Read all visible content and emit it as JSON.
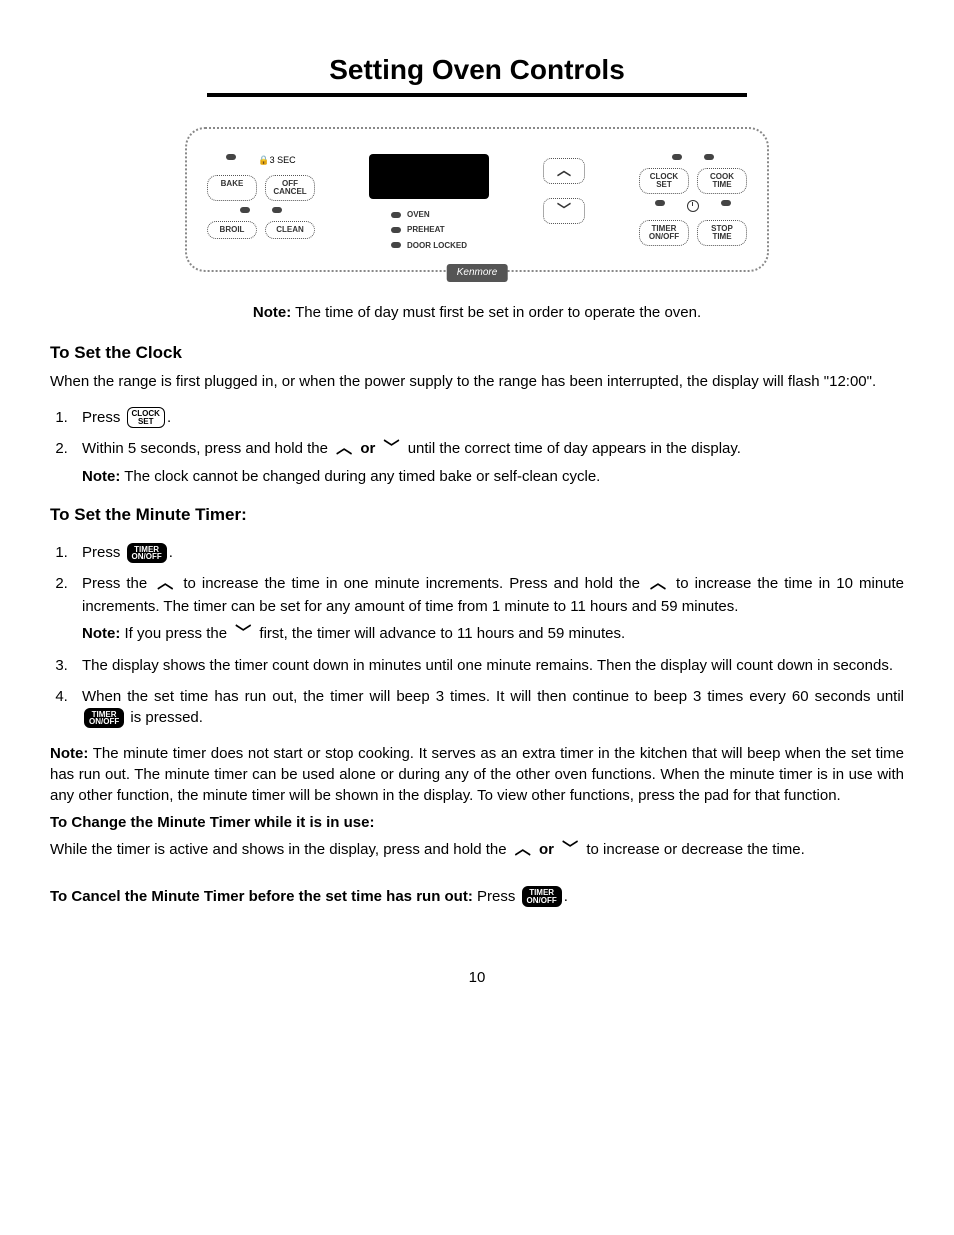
{
  "title": "Setting Oven Controls",
  "panel": {
    "brand": "Kenmore",
    "lock_label": "3 SEC",
    "pads": {
      "bake": "BAKE",
      "off_cancel": "OFF\nCANCEL",
      "broil": "BROIL",
      "clean": "CLEAN",
      "clock_set": "CLOCK\nSET",
      "cook_time": "COOK\nTIME",
      "timer_onoff": "TIMER\nON/OFF",
      "stop_time": "STOP\nTIME"
    },
    "indicators": {
      "oven": "OVEN",
      "preheat": "PREHEAT",
      "door_locked": "DOOR LOCKED"
    }
  },
  "note_top": {
    "label": "Note:",
    "text": "The time of day must first be set in order to operate the oven."
  },
  "clock": {
    "heading": "To Set the Clock",
    "intro": "When the range is first plugged in, or when the power supply to the range has been interrupted, the display will flash \"12:00\".",
    "step1_a": "Press",
    "btn_clock": "CLOCK\nSET",
    "period": ".",
    "step2_a": "Within 5 seconds, press and hold the",
    "or": "or",
    "step2_b": "until the correct time of day appears in the display.",
    "note_label": "Note:",
    "note_text": "The clock cannot be changed during any timed bake or self-clean cycle."
  },
  "timer": {
    "heading": "To Set the Minute Timer:",
    "step1_a": "Press",
    "btn_timer": "TIMER\nON/OFF",
    "period": ".",
    "step2_a": "Press the",
    "step2_b": "to increase the time in one minute increments. Press and hold the",
    "step2_c": "to increase the time in 10 minute increments. The timer can be set for any amount of time from 1 minute to 11 hours and 59 minutes.",
    "step2_note_label": "Note:",
    "step2_note_a": "If you press the",
    "step2_note_b": "first, the timer will advance to 11 hours and 59 minutes.",
    "step3": "The display shows the timer count down in minutes until one minute remains. Then the display will count down in seconds.",
    "step4_a": "When the set time has run out, the timer will beep 3 times. It will then continue to beep 3 times every 60 seconds until",
    "step4_b": "is pressed."
  },
  "timer_note": {
    "label": "Note:",
    "text": "The minute timer does not start or stop cooking. It serves as an extra timer in the kitchen that will beep when the set time has run out. The minute timer can be used alone or during any of the other oven functions. When the minute timer is in use with any other function, the minute timer will be shown in the display. To view other functions, press the pad for that function."
  },
  "change": {
    "heading": "To Change the Minute Timer while it is in use:",
    "text_a": "While the timer is active and shows in the display, press and hold the",
    "or": "or",
    "text_b": "to increase or decrease the time."
  },
  "cancel": {
    "heading": "To Cancel the Minute Timer before the set time has run out:",
    "text": "Press",
    "btn_timer": "TIMER\nON/OFF",
    "period": "."
  },
  "page_number": "10"
}
